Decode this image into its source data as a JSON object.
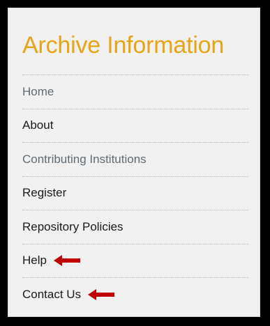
{
  "sidebar": {
    "title": "Archive Information",
    "items": [
      {
        "label": "Home"
      },
      {
        "label": "About"
      },
      {
        "label": "Contributing Institutions"
      },
      {
        "label": "Register"
      },
      {
        "label": "Repository Policies"
      },
      {
        "label": "Help"
      },
      {
        "label": "Contact Us"
      }
    ]
  },
  "annotations": {
    "arrow_color": "#c00000",
    "arrow_icon": "left-arrow-icon"
  },
  "colors": {
    "title": "#e8a317",
    "background": "#f1f1f1",
    "muted_link": "#5f6b74",
    "dark_link": "#1a1a1a",
    "frame": "#000000"
  }
}
